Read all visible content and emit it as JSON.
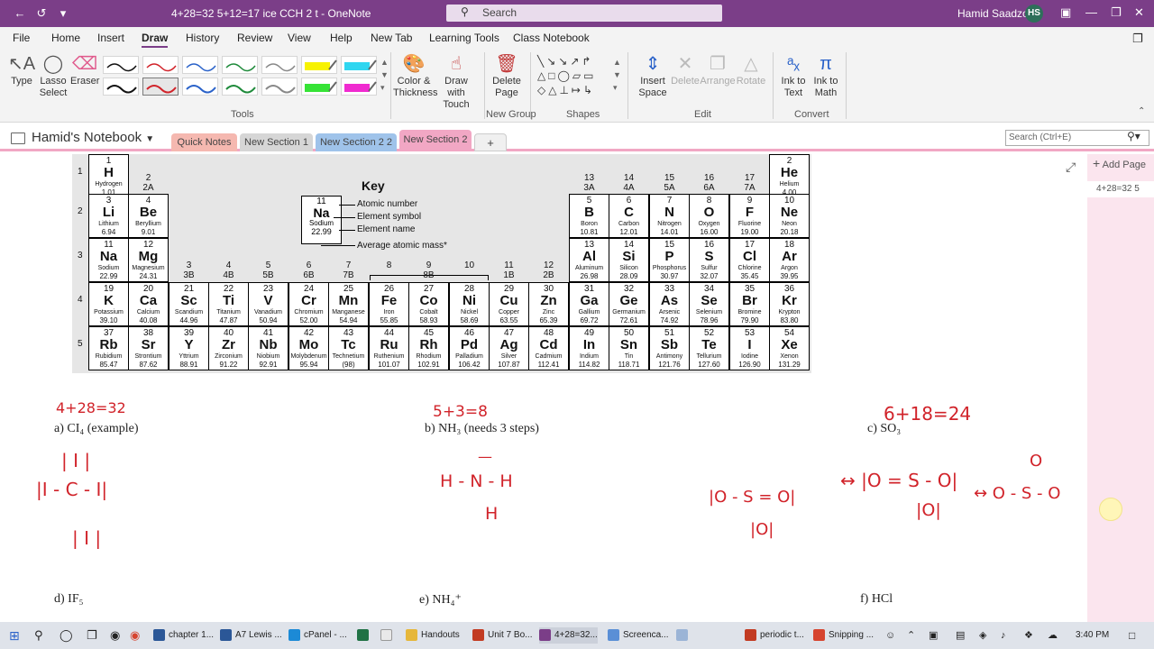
{
  "titlebar": {
    "doc_title": "4+28=32 5+12=17 ice  CCH 2 t  -  OneNote",
    "search_label": "Search",
    "user_name": "Hamid Saadzoi",
    "user_initials": "HS"
  },
  "menu": [
    "File",
    "Home",
    "Insert",
    "Draw",
    "History",
    "Review",
    "View",
    "Help",
    "New Tab",
    "Learning Tools",
    "Class Notebook"
  ],
  "ribbon": {
    "type": "Type",
    "lasso": "Lasso Select",
    "eraser": "Eraser",
    "tools_group": "Tools",
    "color_thickness": "Color & Thickness",
    "draw_touch": "Draw with Touch",
    "delete_page": "Delete Page",
    "new_group": "New Group",
    "shapes_group": "Shapes",
    "insert_space": "Insert Space",
    "delete": "Delete",
    "arrange": "Arrange",
    "rotate": "Rotate",
    "edit_group": "Edit",
    "ink_text": "Ink to Text",
    "ink_math": "Ink to Math",
    "convert_group": "Convert"
  },
  "notebook": {
    "name": "Hamid's Notebook",
    "sections": [
      "Quick Notes",
      "New Section 1",
      "New Section 2 2",
      "New Section 2"
    ],
    "add_tab": "+",
    "search_placeholder": "Search (Ctrl+E)"
  },
  "pagepane": {
    "add_page": "Add Page",
    "page_title": "4+28=32 5"
  },
  "ptable": {
    "key_title": "Key",
    "key_number": "11",
    "key_symbol": "Na",
    "key_name": "Sodium",
    "key_mass": "22.99",
    "key_labels": [
      "Atomic number",
      "Element symbol",
      "Element name",
      "Average atomic mass*"
    ],
    "periods": [
      "1",
      "2",
      "3",
      "4",
      "5"
    ],
    "groups": [
      {
        "id": "g1",
        "num": "1",
        "sub": ""
      },
      {
        "id": "g2",
        "num": "2",
        "sub": "2A"
      },
      {
        "id": "g3",
        "num": "3",
        "sub": "3B"
      },
      {
        "id": "g4",
        "num": "4",
        "sub": "4B"
      },
      {
        "id": "g5",
        "num": "5",
        "sub": "5B"
      },
      {
        "id": "g6",
        "num": "6",
        "sub": "6B"
      },
      {
        "id": "g7",
        "num": "7",
        "sub": "7B"
      },
      {
        "id": "g8",
        "num": "8",
        "sub": ""
      },
      {
        "id": "g9",
        "num": "9",
        "sub": "8B"
      },
      {
        "id": "g10",
        "num": "10",
        "sub": ""
      },
      {
        "id": "g11",
        "num": "11",
        "sub": "1B"
      },
      {
        "id": "g12",
        "num": "12",
        "sub": "2B"
      },
      {
        "id": "g13",
        "num": "13",
        "sub": "3A"
      },
      {
        "id": "g14",
        "num": "14",
        "sub": "4A"
      },
      {
        "id": "g15",
        "num": "15",
        "sub": "5A"
      },
      {
        "id": "g16",
        "num": "16",
        "sub": "6A"
      },
      {
        "id": "g17",
        "num": "17",
        "sub": "7A"
      },
      {
        "id": "g18",
        "num": "2",
        "sub": ""
      }
    ],
    "elements": [
      {
        "z": "1",
        "s": "H",
        "n": "Hydrogen",
        "m": "1.01",
        "c": 1,
        "r": 1
      },
      {
        "z": "2",
        "s": "He",
        "n": "Helium",
        "m": "4.00",
        "c": 18,
        "r": 1
      },
      {
        "z": "3",
        "s": "Li",
        "n": "Lithium",
        "m": "6.94",
        "c": 1,
        "r": 2
      },
      {
        "z": "4",
        "s": "Be",
        "n": "Beryllium",
        "m": "9.01",
        "c": 2,
        "r": 2
      },
      {
        "z": "5",
        "s": "B",
        "n": "Boron",
        "m": "10.81",
        "c": 13,
        "r": 2
      },
      {
        "z": "6",
        "s": "C",
        "n": "Carbon",
        "m": "12.01",
        "c": 14,
        "r": 2
      },
      {
        "z": "7",
        "s": "N",
        "n": "Nitrogen",
        "m": "14.01",
        "c": 15,
        "r": 2
      },
      {
        "z": "8",
        "s": "O",
        "n": "Oxygen",
        "m": "16.00",
        "c": 16,
        "r": 2
      },
      {
        "z": "9",
        "s": "F",
        "n": "Fluorine",
        "m": "19.00",
        "c": 17,
        "r": 2
      },
      {
        "z": "10",
        "s": "Ne",
        "n": "Neon",
        "m": "20.18",
        "c": 18,
        "r": 2
      },
      {
        "z": "11",
        "s": "Na",
        "n": "Sodium",
        "m": "22.99",
        "c": 1,
        "r": 3
      },
      {
        "z": "12",
        "s": "Mg",
        "n": "Magnesium",
        "m": "24.31",
        "c": 2,
        "r": 3
      },
      {
        "z": "13",
        "s": "Al",
        "n": "Aluminum",
        "m": "26.98",
        "c": 13,
        "r": 3
      },
      {
        "z": "14",
        "s": "Si",
        "n": "Silicon",
        "m": "28.09",
        "c": 14,
        "r": 3
      },
      {
        "z": "15",
        "s": "P",
        "n": "Phosphorus",
        "m": "30.97",
        "c": 15,
        "r": 3
      },
      {
        "z": "16",
        "s": "S",
        "n": "Sulfur",
        "m": "32.07",
        "c": 16,
        "r": 3
      },
      {
        "z": "17",
        "s": "Cl",
        "n": "Chlorine",
        "m": "35.45",
        "c": 17,
        "r": 3
      },
      {
        "z": "18",
        "s": "Ar",
        "n": "Argon",
        "m": "39.95",
        "c": 18,
        "r": 3
      },
      {
        "z": "19",
        "s": "K",
        "n": "Potassium",
        "m": "39.10",
        "c": 1,
        "r": 4
      },
      {
        "z": "20",
        "s": "Ca",
        "n": "Calcium",
        "m": "40.08",
        "c": 2,
        "r": 4
      },
      {
        "z": "21",
        "s": "Sc",
        "n": "Scandium",
        "m": "44.96",
        "c": 3,
        "r": 4
      },
      {
        "z": "22",
        "s": "Ti",
        "n": "Titanium",
        "m": "47.87",
        "c": 4,
        "r": 4
      },
      {
        "z": "23",
        "s": "V",
        "n": "Vanadium",
        "m": "50.94",
        "c": 5,
        "r": 4
      },
      {
        "z": "24",
        "s": "Cr",
        "n": "Chromium",
        "m": "52.00",
        "c": 6,
        "r": 4
      },
      {
        "z": "25",
        "s": "Mn",
        "n": "Manganese",
        "m": "54.94",
        "c": 7,
        "r": 4
      },
      {
        "z": "26",
        "s": "Fe",
        "n": "Iron",
        "m": "55.85",
        "c": 8,
        "r": 4
      },
      {
        "z": "27",
        "s": "Co",
        "n": "Cobalt",
        "m": "58.93",
        "c": 9,
        "r": 4
      },
      {
        "z": "28",
        "s": "Ni",
        "n": "Nickel",
        "m": "58.69",
        "c": 10,
        "r": 4
      },
      {
        "z": "29",
        "s": "Cu",
        "n": "Copper",
        "m": "63.55",
        "c": 11,
        "r": 4
      },
      {
        "z": "30",
        "s": "Zn",
        "n": "Zinc",
        "m": "65.39",
        "c": 12,
        "r": 4
      },
      {
        "z": "31",
        "s": "Ga",
        "n": "Gallium",
        "m": "69.72",
        "c": 13,
        "r": 4
      },
      {
        "z": "32",
        "s": "Ge",
        "n": "Germanium",
        "m": "72.61",
        "c": 14,
        "r": 4
      },
      {
        "z": "33",
        "s": "As",
        "n": "Arsenic",
        "m": "74.92",
        "c": 15,
        "r": 4
      },
      {
        "z": "34",
        "s": "Se",
        "n": "Selenium",
        "m": "78.96",
        "c": 16,
        "r": 4
      },
      {
        "z": "35",
        "s": "Br",
        "n": "Bromine",
        "m": "79.90",
        "c": 17,
        "r": 4
      },
      {
        "z": "36",
        "s": "Kr",
        "n": "Krypton",
        "m": "83.80",
        "c": 18,
        "r": 4
      },
      {
        "z": "37",
        "s": "Rb",
        "n": "Rubidium",
        "m": "85.47",
        "c": 1,
        "r": 5
      },
      {
        "z": "38",
        "s": "Sr",
        "n": "Strontium",
        "m": "87.62",
        "c": 2,
        "r": 5
      },
      {
        "z": "39",
        "s": "Y",
        "n": "Yttrium",
        "m": "88.91",
        "c": 3,
        "r": 5
      },
      {
        "z": "40",
        "s": "Zr",
        "n": "Zirconium",
        "m": "91.22",
        "c": 4,
        "r": 5
      },
      {
        "z": "41",
        "s": "Nb",
        "n": "Niobium",
        "m": "92.91",
        "c": 5,
        "r": 5
      },
      {
        "z": "42",
        "s": "Mo",
        "n": "Molybdenum",
        "m": "95.94",
        "c": 6,
        "r": 5
      },
      {
        "z": "43",
        "s": "Tc",
        "n": "Technetium",
        "m": "(98)",
        "c": 7,
        "r": 5
      },
      {
        "z": "44",
        "s": "Ru",
        "n": "Ruthenium",
        "m": "101.07",
        "c": 8,
        "r": 5
      },
      {
        "z": "45",
        "s": "Rh",
        "n": "Rhodium",
        "m": "102.91",
        "c": 9,
        "r": 5
      },
      {
        "z": "46",
        "s": "Pd",
        "n": "Palladium",
        "m": "106.42",
        "c": 10,
        "r": 5
      },
      {
        "z": "47",
        "s": "Ag",
        "n": "Silver",
        "m": "107.87",
        "c": 11,
        "r": 5
      },
      {
        "z": "48",
        "s": "Cd",
        "n": "Cadmium",
        "m": "112.41",
        "c": 12,
        "r": 5
      },
      {
        "z": "49",
        "s": "In",
        "n": "Indium",
        "m": "114.82",
        "c": 13,
        "r": 5
      },
      {
        "z": "50",
        "s": "Sn",
        "n": "Tin",
        "m": "118.71",
        "c": 14,
        "r": 5
      },
      {
        "z": "51",
        "s": "Sb",
        "n": "Antimony",
        "m": "121.76",
        "c": 15,
        "r": 5
      },
      {
        "z": "52",
        "s": "Te",
        "n": "Tellurium",
        "m": "127.60",
        "c": 16,
        "r": 5
      },
      {
        "z": "53",
        "s": "I",
        "n": "Iodine",
        "m": "126.90",
        "c": 17,
        "r": 5
      },
      {
        "z": "54",
        "s": "Xe",
        "n": "Xenon",
        "m": "131.29",
        "c": 18,
        "r": 5
      }
    ]
  },
  "questions": {
    "a": "a) CI₄    (example)",
    "b": "b) NH₃ (needs 3 steps)",
    "c": "c) SO₃",
    "d": "d) IF₅",
    "e": "e) NH₄⁺",
    "f": "f) HCl"
  },
  "handwriting": {
    "a_calc": "4+28=32",
    "b_calc": "5+3=8",
    "c_calc": "6+18=24",
    "cl4_top": "| I |",
    "cl4_mid": "|I - C - I|",
    "cl4_bot": "| I |",
    "nh3_top": "—",
    "nh3_mid": "H - N - H",
    "nh3_bot": "H",
    "so3_a": "|O - S = O|",
    "so3_a_bot": "|O|",
    "so3_b": "↔ |O = S - O|",
    "so3_b_bot": "|O|",
    "so3_c": "↔ O - S - O",
    "so3_c_top": "O"
  },
  "taskbar": {
    "items": [
      "chapter 1...",
      "A7 Lewis ...",
      "cPanel - ...",
      "Handouts",
      "Unit 7 Bo...",
      "4+28=32...",
      "Screenca...",
      "periodic t...",
      "Snipping ..."
    ],
    "time": "3:40 PM"
  },
  "colors": {
    "accent": "#7b3e88",
    "ink": "#d1232a"
  }
}
